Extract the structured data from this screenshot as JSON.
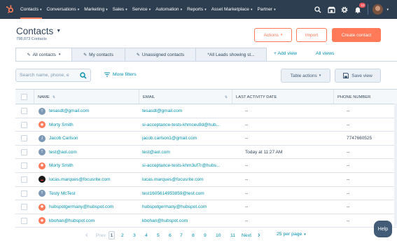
{
  "nav": {
    "items": [
      "Contacts",
      "Conversations",
      "Marketing",
      "Sales",
      "Service",
      "Automation",
      "Reports",
      "Asset Marketplace",
      "Partner"
    ],
    "notification_count": "10",
    "accent": "#ff7a59",
    "bg": "#2d3e50"
  },
  "header": {
    "title": "Contacts",
    "subtitle": "798,073 Contacts",
    "actions_label": "Actions",
    "import_label": "Import",
    "create_label": "Create contact"
  },
  "tabs": [
    {
      "label": "All contacts",
      "active": true
    },
    {
      "label": "My contacts",
      "active": false
    },
    {
      "label": "Unassigned contacts",
      "active": false
    },
    {
      "label": "*All Leads showing st...",
      "active": false
    }
  ],
  "tab_links": {
    "add_view": "+ Add view",
    "all_views": "All views"
  },
  "toolbar": {
    "search_placeholder": "Search name, phone, e",
    "more_filters": "More filters",
    "table_actions": "Table actions",
    "save_view": "Save view"
  },
  "table": {
    "columns": [
      "NAME",
      "EMAIL",
      "LAST ACTIVITY DATE",
      "PHONE NUMBER"
    ],
    "rows": [
      {
        "avatar": "T",
        "avatar_type": "grey",
        "name": "tesasdt@gmail.com",
        "email": "tesasdt@gmail.com",
        "activity": "--",
        "phone": "--"
      },
      {
        "avatar": "hs",
        "avatar_type": "orange",
        "name": "Morty Smith",
        "email": "si-acceptance-tests-khmceu9d@hub...",
        "activity": "--",
        "phone": "--"
      },
      {
        "avatar": "J",
        "avatar_type": "grey",
        "name": "Jacob Carlson",
        "email": "jacob.carlson1@gmail.com",
        "activity": "--",
        "phone": "7747660525"
      },
      {
        "avatar": "T",
        "avatar_type": "grey",
        "name": "test@aol.com",
        "email": "test@aol.com",
        "activity": "Today at 11:27 AM",
        "phone": "--"
      },
      {
        "avatar": "hs",
        "avatar_type": "orange",
        "name": "Morty Smith",
        "email": "si-acceptance-tests-khm3uf7r@hubs...",
        "activity": "--",
        "phone": "--"
      },
      {
        "avatar": "fs",
        "avatar_type": "black",
        "name": "lucas.marques@focusrite.com",
        "email": "lucas.marques@focusrite.com",
        "activity": "--",
        "phone": "--"
      },
      {
        "avatar": "T",
        "avatar_type": "grey",
        "name": "Testy McTest",
        "email": "test1605614953859@test.com",
        "activity": "--",
        "phone": "--"
      },
      {
        "avatar": "hs",
        "avatar_type": "orange",
        "name": "hubspotgermany@hubspot.com",
        "email": "hubspotgermany@hubspot.com",
        "activity": "--",
        "phone": "--"
      },
      {
        "avatar": "hs",
        "avatar_type": "orange",
        "name": "kbohan@hubspot.com",
        "email": "kbohan@hubspot.com",
        "activity": "--",
        "phone": "--"
      }
    ]
  },
  "pagination": {
    "prev": "Prev",
    "next": "Next",
    "pages": [
      "1",
      "2",
      "3",
      "4",
      "5",
      "6",
      "7",
      "8",
      "9",
      "10",
      "11"
    ],
    "current": "1",
    "per_page": "25 per page"
  },
  "help_label": "Help"
}
